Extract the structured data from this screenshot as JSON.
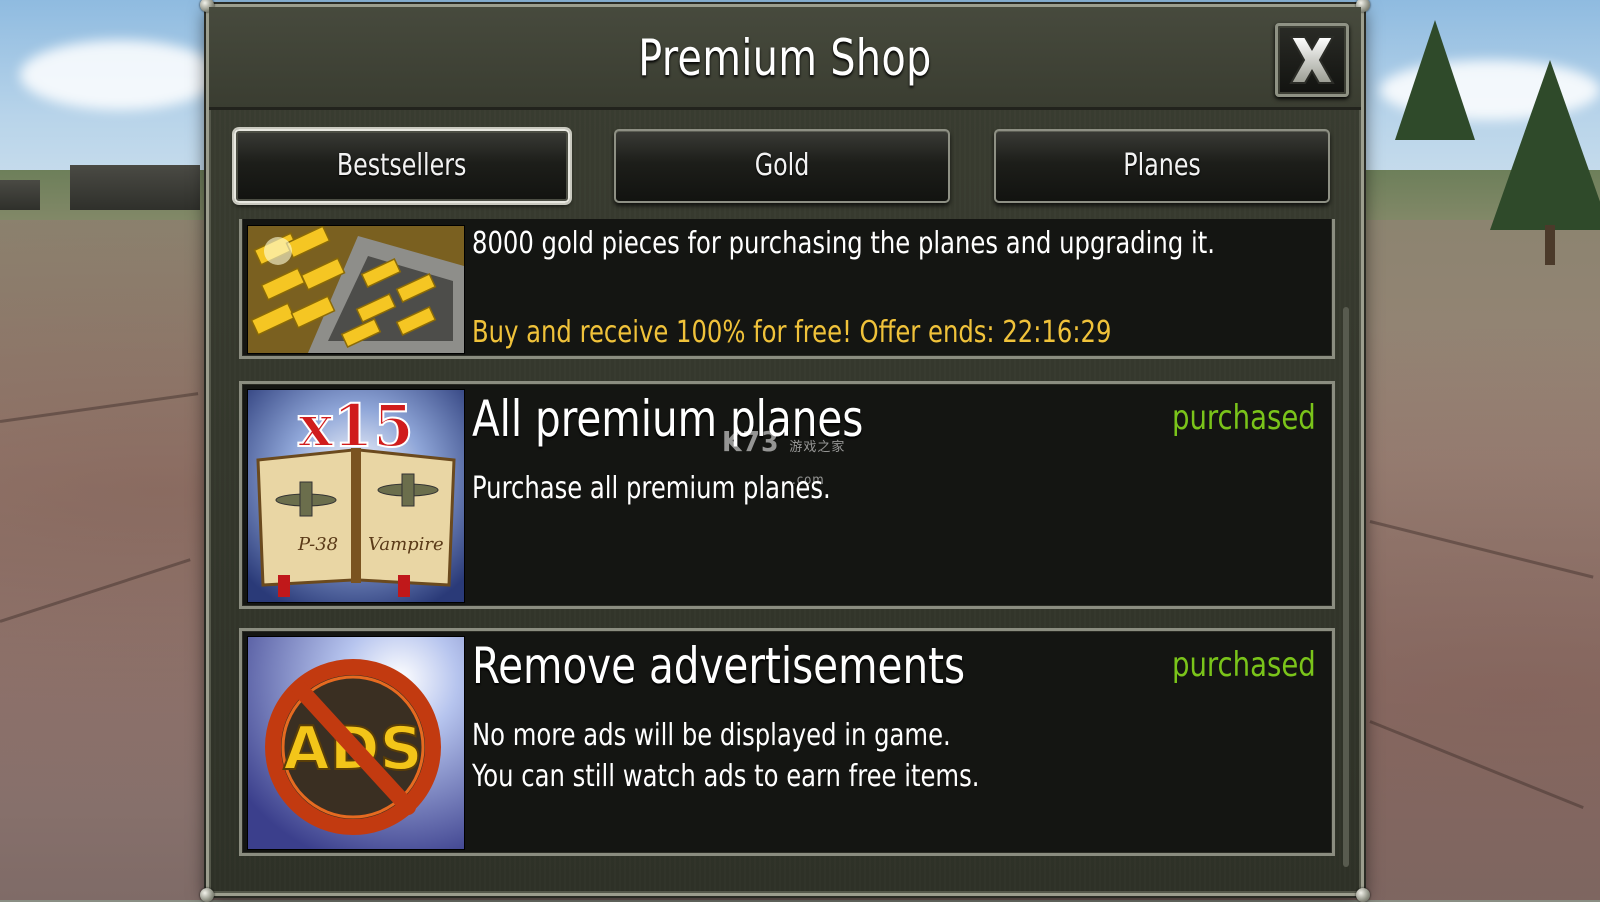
{
  "shop": {
    "title": "Premium Shop",
    "close_label": "close"
  },
  "tabs": [
    {
      "label": "Bestsellers",
      "active": true
    },
    {
      "label": "Gold",
      "active": false
    },
    {
      "label": "Planes",
      "active": false
    }
  ],
  "items": [
    {
      "icon": "gold-bars-icon",
      "description": "8000 gold pieces for purchasing the planes and upgrading it.",
      "offer": "Buy and receive 100% for free!  Offer ends: 22:16:29"
    },
    {
      "icon": "premium-planes-book-icon",
      "title": "All premium planes",
      "description": "Purchase all premium planes.",
      "status": "purchased",
      "badge": "x15",
      "plane_names": [
        "P-38",
        "Vampire"
      ]
    },
    {
      "icon": "no-ads-icon",
      "title": "Remove advertisements",
      "description_line1": "No more ads will be displayed in game.",
      "description_line2": "You can still watch ads to earn free items.",
      "status": "purchased",
      "badge": "ADS"
    }
  ],
  "watermark": {
    "main": "K73",
    "sub": "游戏之家",
    "domain": ".com"
  },
  "colors": {
    "offer_text": "#f0c23a",
    "status_purchased": "#7ac41a",
    "panel_bg": "#141512",
    "frame_metal": "#9c9e8e"
  }
}
